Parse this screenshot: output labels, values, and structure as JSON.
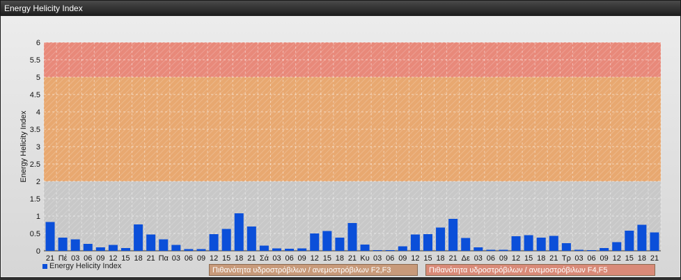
{
  "window": {
    "title": "Energy Helicity Index"
  },
  "legend": {
    "series_label": "Energy Helicity Index",
    "band1_label": "Πιθανότητα υδροστρόβιλων / ανεμοστρόβιλων F2,F3",
    "band2_label": "Πιθανότητα υδροστρόβιλων / ανεμοστρόβιλων F4,F5"
  },
  "colors": {
    "bar": "#0b4fd9",
    "band_low": "#c8c8c8",
    "band_mid": "#e8a870",
    "band_high": "#e8897a",
    "band1_button": "#c89a7a",
    "band2_button": "#d98a78"
  },
  "chart_data": {
    "type": "bar",
    "ylabel": "Energy Helicity Index",
    "xlabel": "",
    "ylim": [
      0,
      6
    ],
    "yticks": [
      0,
      0.5,
      1,
      1.5,
      2,
      2.5,
      3,
      3.5,
      4,
      4.5,
      5,
      5.5,
      6
    ],
    "grid": true,
    "bands": [
      {
        "from": 0,
        "to": 2,
        "color": "#c8c8c8"
      },
      {
        "from": 2,
        "to": 5,
        "color": "#e8a870"
      },
      {
        "from": 5,
        "to": 6,
        "color": "#e8897a"
      }
    ],
    "categories": [
      "21",
      "Πέ",
      "03",
      "06",
      "09",
      "12",
      "15",
      "18",
      "21",
      "Πα",
      "03",
      "06",
      "09",
      "12",
      "15",
      "18",
      "21",
      "Σά",
      "03",
      "06",
      "09",
      "12",
      "15",
      "18",
      "21",
      "Κυ",
      "03",
      "06",
      "09",
      "12",
      "15",
      "18",
      "21",
      "Δε",
      "03",
      "06",
      "09",
      "12",
      "15",
      "18",
      "21",
      "Τρ",
      "03",
      "06",
      "09",
      "12",
      "15",
      "18",
      "21"
    ],
    "series": [
      {
        "name": "Energy Helicity Index",
        "values": [
          0.83,
          0.38,
          0.33,
          0.2,
          0.1,
          0.17,
          0.08,
          0.76,
          0.47,
          0.33,
          0.17,
          0.05,
          0.05,
          0.48,
          0.63,
          1.08,
          0.7,
          0.15,
          0.07,
          0.06,
          0.07,
          0.5,
          0.57,
          0.38,
          0.8,
          0.18,
          0.02,
          0.02,
          0.13,
          0.47,
          0.48,
          0.67,
          0.92,
          0.37,
          0.1,
          0.03,
          0.03,
          0.42,
          0.45,
          0.38,
          0.43,
          0.22,
          0.03,
          0.02,
          0.08,
          0.25,
          0.58,
          0.75,
          0.53
        ]
      }
    ]
  }
}
